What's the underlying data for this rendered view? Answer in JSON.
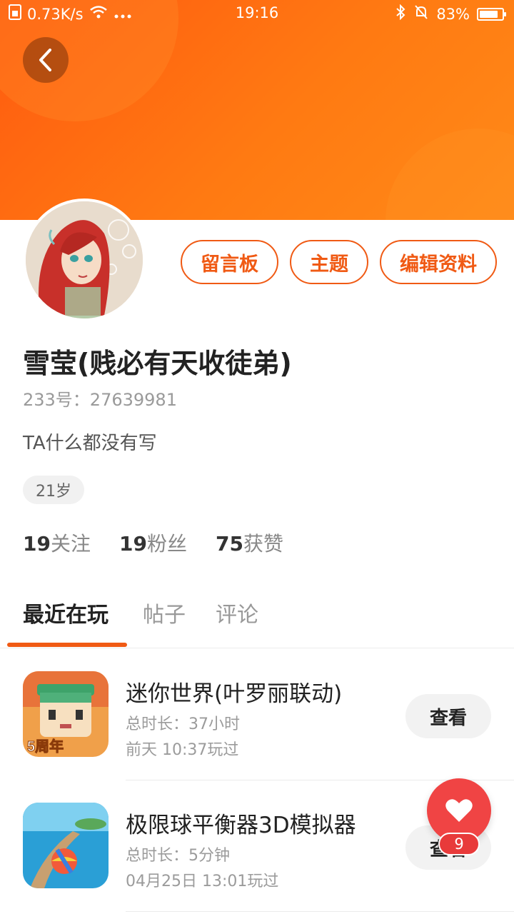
{
  "status_bar": {
    "speed": "0.73K/s",
    "time": "19:16",
    "battery": "83%",
    "battery_level": 0.83
  },
  "profile": {
    "username": "雪莹(贱必有天收徒弟)",
    "id_line": "233号：27639981",
    "bio": "TA什么都没有写",
    "age": "21岁",
    "stats": [
      {
        "num": "19",
        "label": "关注"
      },
      {
        "num": "19",
        "label": "粉丝"
      },
      {
        "num": "75",
        "label": "获赞"
      }
    ]
  },
  "actions": {
    "message_board": "留言板",
    "topics": "主题",
    "edit_profile": "编辑资料"
  },
  "tabs": [
    "最近在玩",
    "帖子",
    "评论"
  ],
  "games": [
    {
      "title": "迷你世界(叶罗丽联动)",
      "duration": "总时长：37小时",
      "last_played": "前天 10:37玩过",
      "button": "查看",
      "icon_text": "5周年"
    },
    {
      "title": "极限球平衡器3D模拟器",
      "duration": "总时长：5分钟",
      "last_played": "04月25日 13:01玩过",
      "button": "查看"
    }
  ],
  "fab": {
    "badge": "9"
  },
  "colors": {
    "accent": "#f05a14",
    "header": "#ff7a12",
    "fab": "#f04444"
  }
}
